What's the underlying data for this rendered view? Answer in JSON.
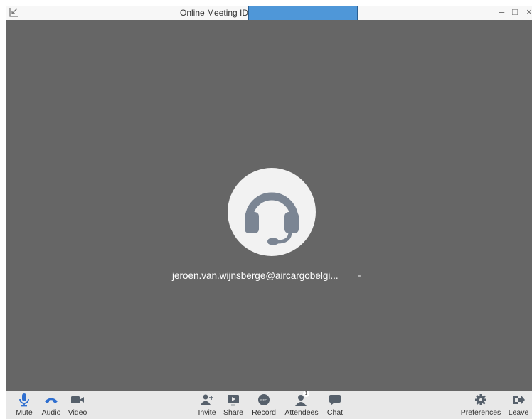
{
  "window": {
    "title": "Online Meeting ID:",
    "controls": {
      "minimize": "–",
      "maximize": "□",
      "close": "×"
    }
  },
  "participant": {
    "name": "jeroen.van.wijnsberge@aircargobelgi...",
    "avatar_icon": "headset-icon"
  },
  "toolbar": {
    "left": [
      {
        "id": "mute",
        "label": "Mute",
        "icon": "microphone-icon"
      },
      {
        "id": "audio",
        "label": "Audio",
        "icon": "phone-icon"
      },
      {
        "id": "video",
        "label": "Video",
        "icon": "video-camera-icon"
      }
    ],
    "center": [
      {
        "id": "invite",
        "label": "Invite",
        "icon": "add-user-icon"
      },
      {
        "id": "share",
        "label": "Share",
        "icon": "share-screen-icon"
      },
      {
        "id": "record",
        "label": "Record",
        "icon": "record-icon",
        "icon_text": "REC"
      },
      {
        "id": "attendees",
        "label": "Attendees",
        "icon": "attendees-icon",
        "badge": "1"
      },
      {
        "id": "chat",
        "label": "Chat",
        "icon": "chat-icon"
      }
    ],
    "right": [
      {
        "id": "preferences",
        "label": "Preferences",
        "icon": "gear-icon"
      },
      {
        "id": "leave",
        "label": "Leave",
        "icon": "leave-icon"
      }
    ]
  },
  "colors": {
    "accent_blue": "#2f6fd0",
    "stage_bg": "#666666",
    "toolbar_bg": "#e8e8e8",
    "icon_gray": "#56606b",
    "id_highlight": "#4f97d8"
  }
}
